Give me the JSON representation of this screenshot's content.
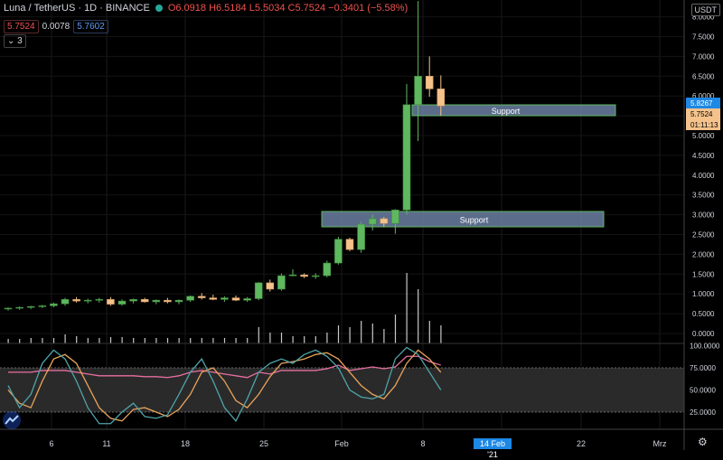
{
  "header": {
    "symbol": "Luna / TetherUS · 1D · BINANCE",
    "ohlc": "O6.0918 H6.5184 L5.5034 C5.7524 −0.3401 (−5.58%)",
    "price_box": "5.7524",
    "spread": "0.0078",
    "ask_box": "5.7602",
    "indicators_count": "3"
  },
  "currency_label": "USDT",
  "price_axis": {
    "ticks": [
      "8.0000",
      "7.5000",
      "7.0000",
      "6.5000",
      "6.0000",
      "5.5000",
      "5.0000",
      "4.5000",
      "4.0000",
      "3.5000",
      "3.0000",
      "2.5000",
      "2.0000",
      "1.5000",
      "1.0000",
      "0.5000",
      "0.0000"
    ],
    "label_current": "5.8267",
    "label_last": "5.7524",
    "countdown": "01:11:13"
  },
  "stoch_axis": {
    "ticks": [
      "100.0000",
      "75.0000",
      "50.0000",
      "25.0000"
    ]
  },
  "time_axis": {
    "labels": [
      "6",
      "11",
      "18",
      "25",
      "Feb",
      "8",
      "14 Feb '21",
      "22",
      "Mrz"
    ],
    "highlight": "14 Feb '21"
  },
  "annotations": [
    {
      "text": "Support"
    },
    {
      "text": "Support"
    }
  ],
  "colors": {
    "up": "#5fb85f",
    "down": "#f5c28b",
    "support_fill": "#6b7fa3",
    "support_border": "#5fb85f",
    "stoch_k": "#4fa3a8",
    "stoch_d": "#e8a35a",
    "rsi": "#e86fa0",
    "band": "#4a4a4a"
  },
  "chart_data": {
    "type": "candlestick",
    "ylim": [
      0,
      8.2
    ],
    "candles": [
      [
        0.62,
        0.66,
        0.58,
        0.64
      ],
      [
        0.64,
        0.68,
        0.6,
        0.66
      ],
      [
        0.66,
        0.7,
        0.62,
        0.68
      ],
      [
        0.68,
        0.72,
        0.64,
        0.7
      ],
      [
        0.7,
        0.78,
        0.66,
        0.75
      ],
      [
        0.75,
        0.9,
        0.7,
        0.86
      ],
      [
        0.86,
        0.92,
        0.78,
        0.82
      ],
      [
        0.82,
        0.88,
        0.76,
        0.84
      ],
      [
        0.84,
        0.9,
        0.78,
        0.86
      ],
      [
        0.86,
        0.92,
        0.7,
        0.74
      ],
      [
        0.74,
        0.86,
        0.7,
        0.82
      ],
      [
        0.82,
        0.88,
        0.76,
        0.86
      ],
      [
        0.86,
        0.9,
        0.78,
        0.8
      ],
      [
        0.8,
        0.86,
        0.74,
        0.84
      ],
      [
        0.84,
        0.9,
        0.76,
        0.8
      ],
      [
        0.8,
        0.86,
        0.74,
        0.84
      ],
      [
        0.84,
        0.96,
        0.8,
        0.94
      ],
      [
        0.94,
        1.02,
        0.86,
        0.9
      ],
      [
        0.9,
        0.98,
        0.84,
        0.86
      ],
      [
        0.86,
        0.94,
        0.8,
        0.9
      ],
      [
        0.9,
        0.96,
        0.82,
        0.84
      ],
      [
        0.84,
        0.92,
        0.8,
        0.88
      ],
      [
        0.88,
        1.3,
        0.84,
        1.28
      ],
      [
        1.28,
        1.36,
        1.06,
        1.12
      ],
      [
        1.12,
        1.52,
        1.08,
        1.46
      ],
      [
        1.46,
        1.62,
        1.44,
        1.48
      ],
      [
        1.48,
        1.52,
        1.4,
        1.44
      ],
      [
        1.44,
        1.52,
        1.38,
        1.46
      ],
      [
        1.46,
        1.84,
        1.42,
        1.78
      ],
      [
        1.78,
        2.44,
        1.74,
        2.38
      ],
      [
        2.38,
        2.42,
        2.08,
        2.12
      ],
      [
        2.12,
        2.82,
        2.04,
        2.76
      ],
      [
        2.76,
        3.0,
        2.6,
        2.9
      ],
      [
        2.9,
        2.94,
        2.7,
        2.78
      ],
      [
        2.78,
        3.14,
        2.52,
        3.12
      ],
      [
        3.12,
        6.3,
        3.0,
        5.78
      ],
      [
        5.78,
        8.4,
        4.86,
        6.5
      ],
      [
        6.5,
        7.0,
        5.98,
        6.18
      ],
      [
        6.18,
        6.52,
        5.5,
        5.75
      ]
    ],
    "volumes": [
      0.05,
      0.05,
      0.06,
      0.06,
      0.06,
      0.1,
      0.08,
      0.06,
      0.06,
      0.07,
      0.07,
      0.06,
      0.06,
      0.06,
      0.06,
      0.06,
      0.06,
      0.06,
      0.06,
      0.06,
      0.06,
      0.06,
      0.18,
      0.12,
      0.12,
      0.08,
      0.08,
      0.08,
      0.12,
      0.2,
      0.18,
      0.25,
      0.22,
      0.16,
      0.32,
      0.78,
      0.6,
      0.25,
      0.2
    ],
    "stoch_k": [
      55,
      30,
      45,
      80,
      95,
      85,
      60,
      30,
      12,
      12,
      25,
      35,
      20,
      18,
      22,
      45,
      70,
      85,
      60,
      30,
      15,
      40,
      70,
      80,
      85,
      80,
      90,
      95,
      88,
      75,
      50,
      42,
      40,
      45,
      85,
      98,
      90,
      70,
      50
    ],
    "stoch_d": [
      50,
      35,
      30,
      60,
      85,
      90,
      80,
      55,
      30,
      18,
      15,
      28,
      30,
      25,
      20,
      28,
      45,
      70,
      75,
      60,
      38,
      30,
      45,
      65,
      80,
      82,
      85,
      90,
      92,
      85,
      70,
      55,
      45,
      40,
      55,
      80,
      95,
      85,
      70
    ],
    "rsi": [
      70,
      70,
      70,
      72,
      72,
      72,
      70,
      68,
      66,
      66,
      66,
      66,
      65,
      65,
      64,
      66,
      70,
      72,
      70,
      68,
      66,
      64,
      70,
      68,
      72,
      72,
      72,
      72,
      74,
      78,
      72,
      74,
      76,
      74,
      76,
      88,
      88,
      82,
      78
    ]
  }
}
